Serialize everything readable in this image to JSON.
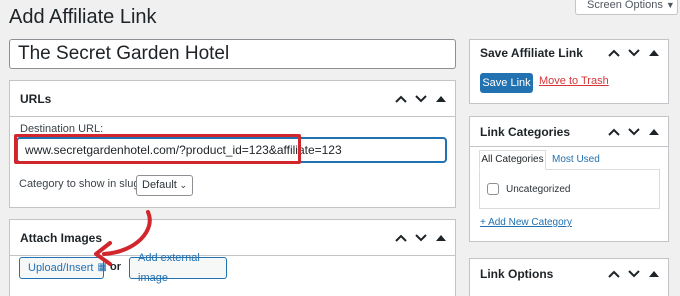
{
  "page": {
    "title": "Add Affiliate Link"
  },
  "screen_options": {
    "label": "Screen Options",
    "icon": "caret-down-icon"
  },
  "title_field": {
    "value": "The Secret Garden Hotel"
  },
  "urls_box": {
    "title": "URLs",
    "destination_label": "Destination URL:",
    "destination_value": "www.secretgardenhotel.com/?product_id=123&affiliate=123",
    "slug_label": "Category to show in slug:",
    "slug_selected": "Default"
  },
  "attach_box": {
    "title": "Attach Images",
    "upload_label": "Upload/Insert",
    "or_label": "or",
    "external_label": "Add external image"
  },
  "save_box": {
    "title": "Save Affiliate Link",
    "save_label": "Save Link",
    "trash_label": "Move to Trash"
  },
  "categories_box": {
    "title": "Link Categories",
    "tabs": [
      {
        "label": "All Categories"
      },
      {
        "label": "Most Used"
      }
    ],
    "items": [
      {
        "label": "Uncategorized"
      }
    ],
    "add_label": "+ Add New Category"
  },
  "options_box": {
    "title": "Link Options"
  },
  "colors": {
    "accent": "#2271b1",
    "annotation": "#d0262c",
    "trash": "#d63638",
    "background": "#f0f0f1"
  }
}
